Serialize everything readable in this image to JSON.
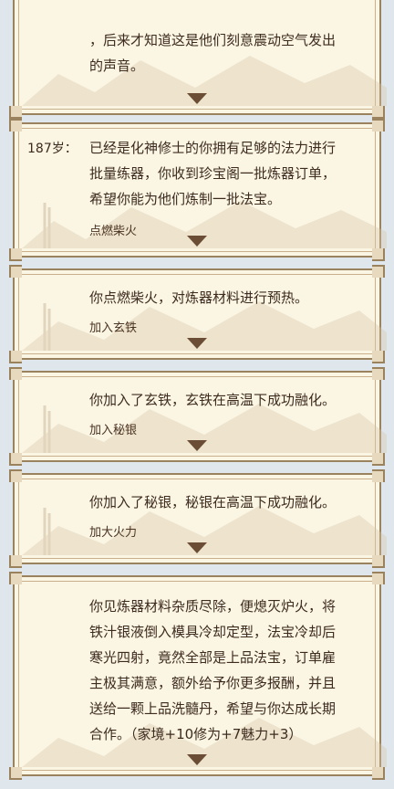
{
  "cards": [
    {
      "age": "",
      "text": "，后来才知道这是他们刻意震动空气发出\n的声音。",
      "choice": ""
    },
    {
      "age": "187岁：",
      "text": "已经是化神修士的你拥有足够的法力进行\n批量练器，你收到珍宝阁一批炼器订单，\n希望你能为他们炼制一批法宝。",
      "choice": "点燃柴火"
    },
    {
      "age": "",
      "text": "你点燃柴火，对炼器材料进行预热。",
      "choice": "加入玄铁"
    },
    {
      "age": "",
      "text": "你加入了玄铁，玄铁在高温下成功融化。",
      "choice": "加入秘银"
    },
    {
      "age": "",
      "text": "你加入了秘银，秘银在高温下成功融化。",
      "choice": "加大火力"
    },
    {
      "age": "",
      "text": "你见炼器材料杂质尽除，便熄灭炉火，将\n铁汁银液倒入模具冷却定型，法宝冷却后\n寒光四射，竟然全部是上品法宝，订单雇\n主极其满意，额外给予你更多报酬，并且\n送给一颗上品洗髓丹，希望与你达成长期\n合作。（家境+10修为+7魅力+3）",
      "choice": ""
    }
  ]
}
